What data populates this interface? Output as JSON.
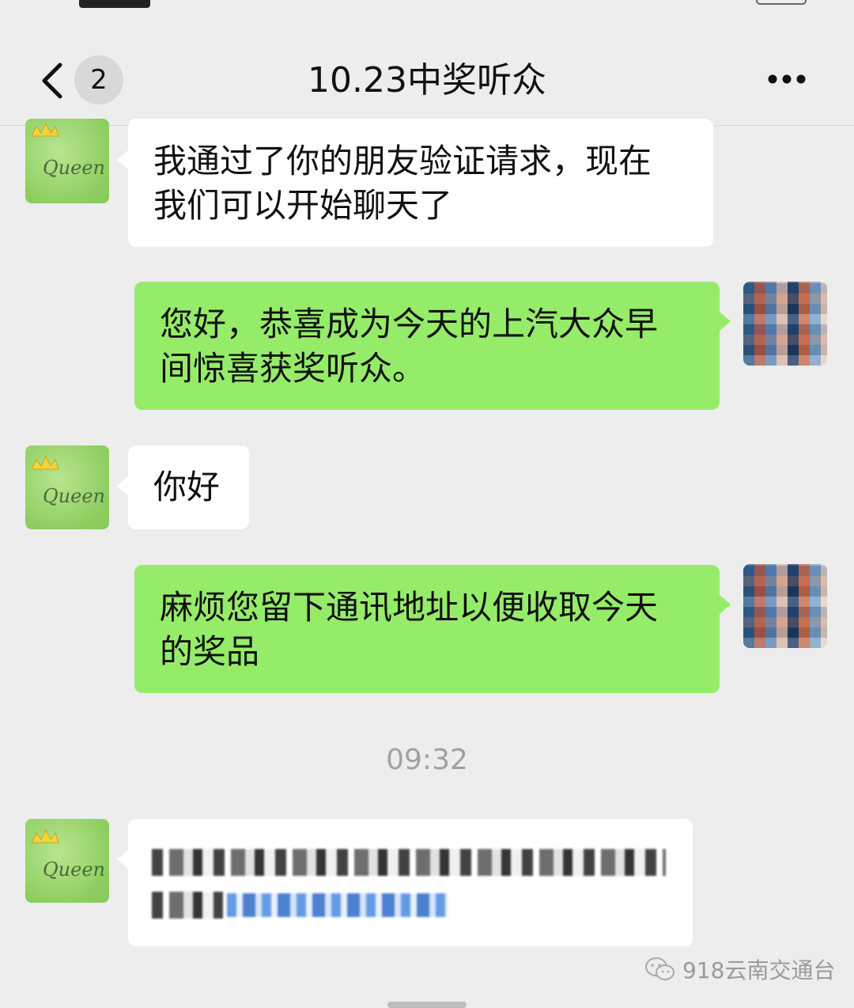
{
  "header": {
    "back_badge": "2",
    "title": "10.23中奖听众"
  },
  "messages": [
    {
      "side": "left",
      "text_line1": "我通过了你的朋友验证请求，现在",
      "text_line2": "我们可以开始聊天了"
    },
    {
      "side": "right",
      "text_line1": "您好，恭喜成为今天的上汽大众早",
      "text_line2": "间惊喜获奖听众。"
    },
    {
      "side": "left",
      "text": "你好"
    },
    {
      "side": "right",
      "text_line1": "麻烦您留下通讯地址以便收取今天",
      "text_line2": "的奖品"
    }
  ],
  "timestamp": "09:32",
  "avatar_left_label": "Queen",
  "watermark": "918云南交通台",
  "colors": {
    "background": "#ededed",
    "bubble_self": "#95ec69",
    "bubble_other": "#ffffff"
  }
}
